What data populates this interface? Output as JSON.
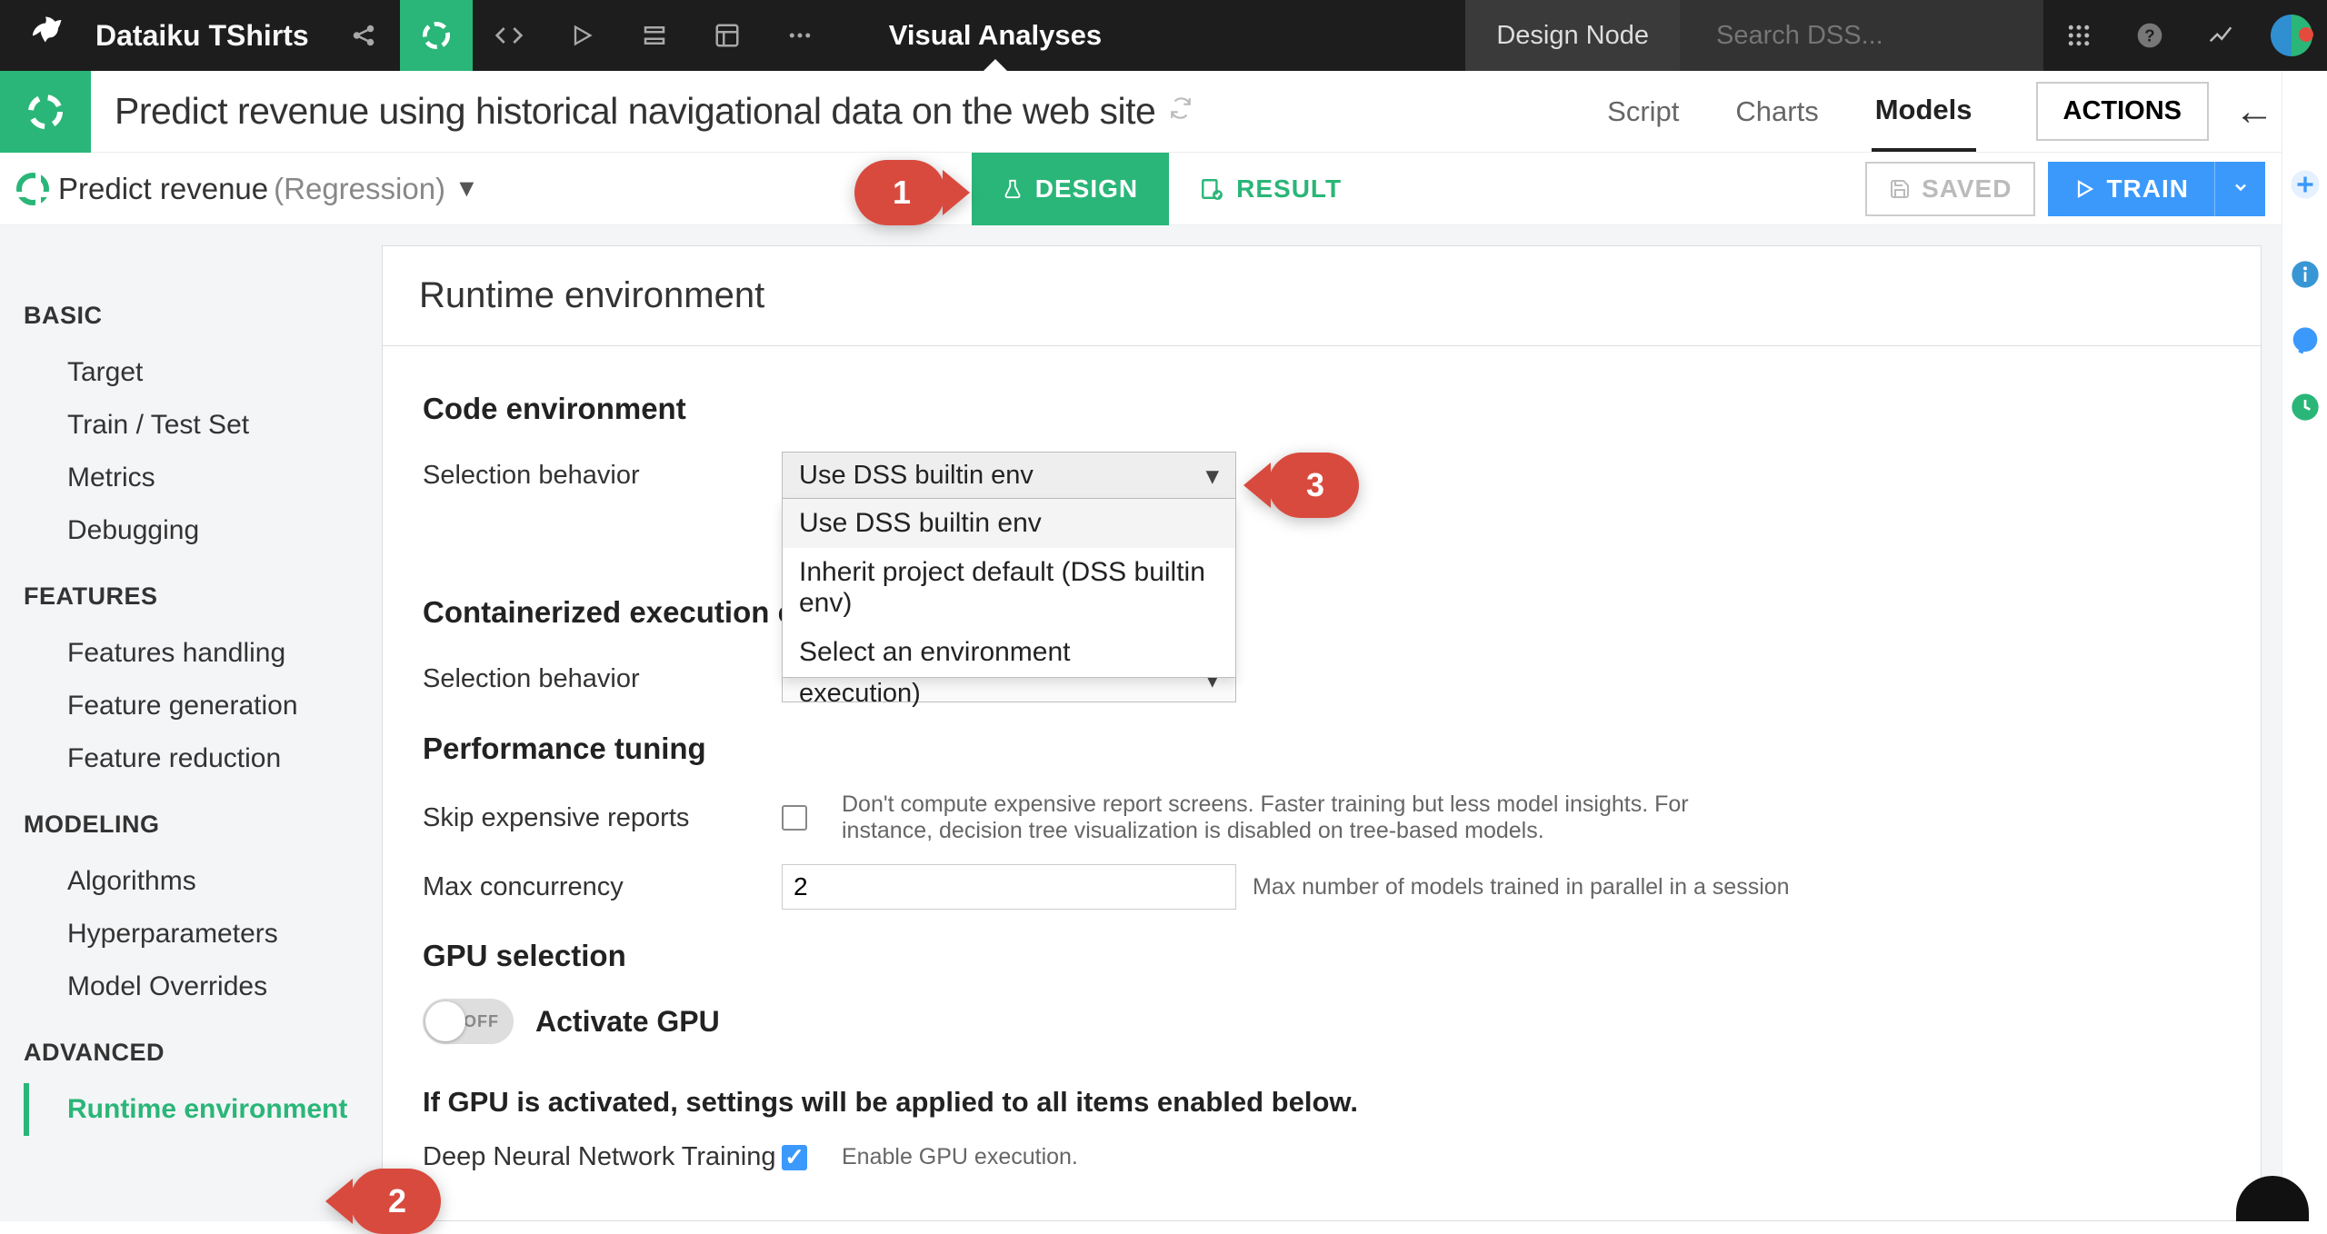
{
  "colors": {
    "accent_green": "#2ab678",
    "accent_blue": "#3b99fc",
    "callout_red": "#d94a3e"
  },
  "topbar": {
    "project": "Dataiku TShirts",
    "breadcrumb": "Visual Analyses",
    "design_node": "Design Node",
    "search_placeholder": "Search DSS..."
  },
  "title_row": {
    "title": "Predict revenue using historical navigational data on the web site",
    "tabs": [
      "Script",
      "Charts",
      "Models"
    ],
    "active_tab": "Models",
    "actions_btn": "ACTIONS"
  },
  "subbar": {
    "model_name": "Predict revenue",
    "model_type": "(Regression)",
    "design_btn": "DESIGN",
    "result_btn": "RESULT",
    "saved_btn": "SAVED",
    "train_btn": "TRAIN"
  },
  "callouts": {
    "c1": "1",
    "c2": "2",
    "c3": "3"
  },
  "sidebar": {
    "groups": [
      {
        "label": "BASIC",
        "items": [
          "Target",
          "Train / Test Set",
          "Metrics",
          "Debugging"
        ]
      },
      {
        "label": "FEATURES",
        "items": [
          "Features handling",
          "Feature generation",
          "Feature reduction"
        ]
      },
      {
        "label": "MODELING",
        "items": [
          "Algorithms",
          "Hyperparameters",
          "Model Overrides"
        ]
      },
      {
        "label": "ADVANCED",
        "items": [
          "Runtime environment"
        ]
      }
    ],
    "active": "Runtime environment"
  },
  "content": {
    "page_title": "Runtime environment",
    "code_env": {
      "heading": "Code environment",
      "label": "Selection behavior",
      "value": "Use DSS builtin env",
      "options": [
        "Use DSS builtin env",
        "Inherit project default (DSS builtin env)",
        "Select an environment"
      ]
    },
    "containerized": {
      "heading": "Containerized execution conf",
      "label": "Selection behavior",
      "value": "Inherit project default (local execution)"
    },
    "perf": {
      "heading": "Performance tuning",
      "skip_label": "Skip expensive reports",
      "skip_help": "Don't compute expensive report screens. Faster training but less model insights. For instance, decision tree visualization is disabled on tree-based models.",
      "max_label": "Max concurrency",
      "max_value": "2",
      "max_help": "Max number of models trained in parallel in a session"
    },
    "gpu": {
      "heading": "GPU selection",
      "toggle_text": "OFF",
      "toggle_label": "Activate GPU",
      "note": "If GPU is activated, settings will be applied to all items enabled below.",
      "dnn_label": "Deep Neural Network Training",
      "dnn_help": "Enable GPU execution."
    }
  }
}
